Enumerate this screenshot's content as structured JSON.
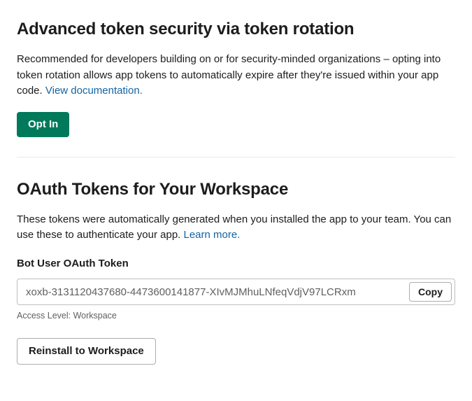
{
  "rotation": {
    "heading": "Advanced token security via token rotation",
    "description": "Recommended for developers building on or for security-minded organizations – opting into token rotation allows app tokens to automatically expire after they're issued within your app code. ",
    "doc_link": "View documentation.",
    "opt_in_button": "Opt In"
  },
  "oauth": {
    "heading": "OAuth Tokens for Your Workspace",
    "description": "These tokens were automatically generated when you installed the app to your team. You can use these to authenticate your app. ",
    "learn_more": "Learn more.",
    "bot_token_label": "Bot User OAuth Token",
    "bot_token_value": "xoxb-3131120437680-4473600141877-XIvMJMhuLNfeqVdjV97LCRxm",
    "copy_button": "Copy",
    "access_level": "Access Level: Workspace",
    "reinstall_button": "Reinstall to Workspace"
  }
}
